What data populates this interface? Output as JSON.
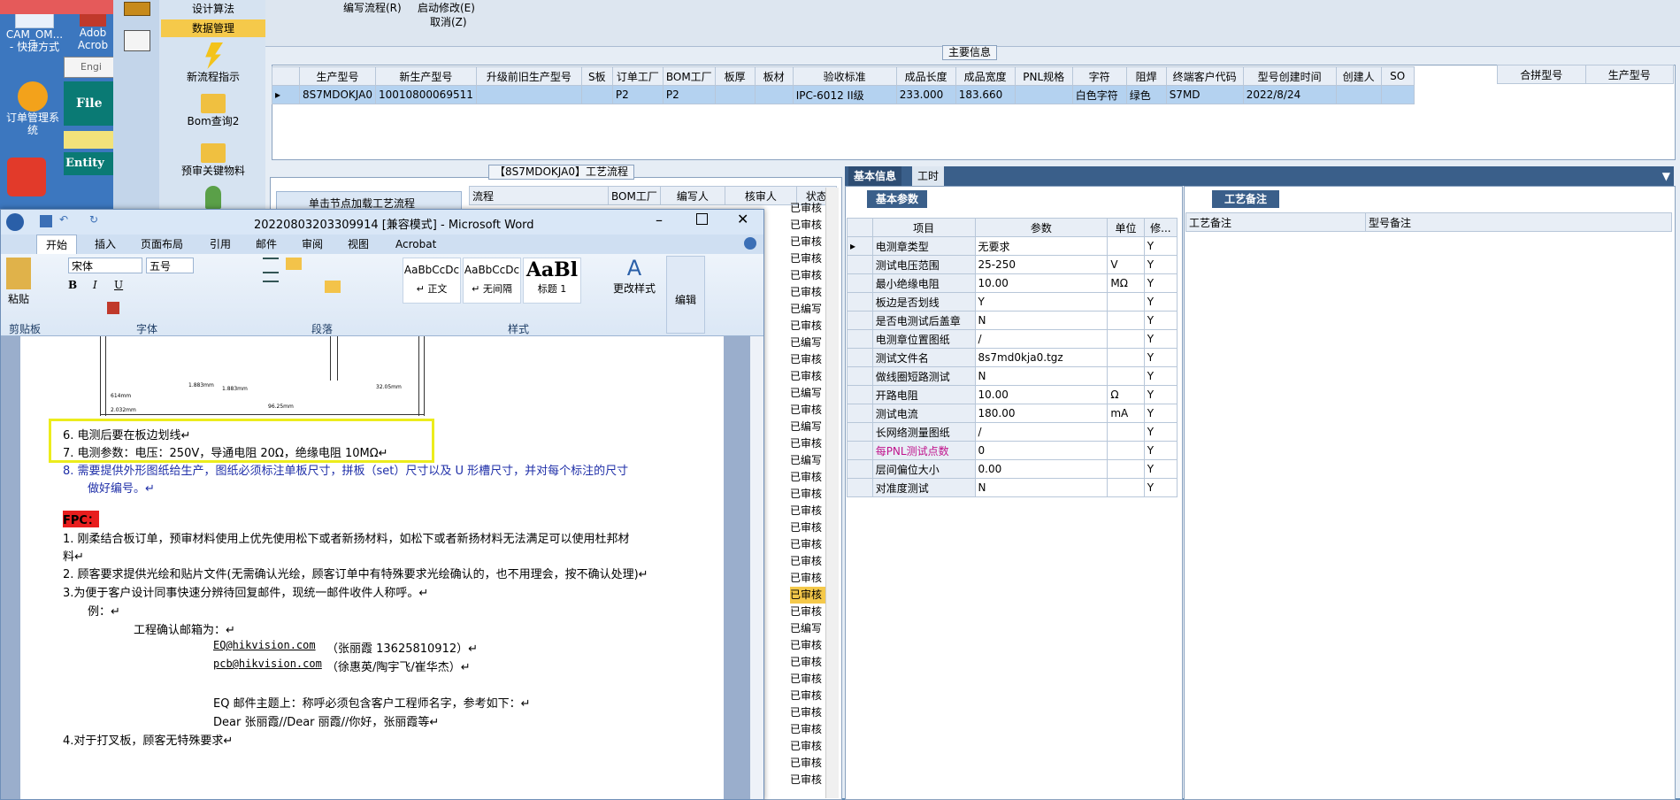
{
  "desktop": {
    "icons": [
      {
        "label": "CAM_OM...\n- 快捷方式"
      },
      {
        "label": "Adob\nAcrob"
      },
      {
        "label": "订单管理系\n统"
      }
    ],
    "engine_label": "Engi",
    "file_label": "File",
    "entity_label": "Entity"
  },
  "nav": {
    "item_algorithm": "设计算法",
    "item_data": "数据管理",
    "tool_new_flow": "新流程指示",
    "tool_bom": "Bom查询2",
    "tool_preaudit": "预审关键物料"
  },
  "menu": {
    "edit_flow": "编写流程(R)",
    "start_modify": "启动修改(E)",
    "cancel": "取消(Z)"
  },
  "main_info": {
    "title": "主要信息",
    "headers": [
      "生产型号",
      "新生产型号",
      "升级前旧生产型号",
      "S板",
      "订单工厂",
      "BOM工厂",
      "板厚",
      "板材",
      "验收标准",
      "成品长度",
      "成品宽度",
      "PNL规格",
      "字符",
      "阻焊",
      "终端客户代码",
      "型号创建时间",
      "创建人",
      "SO"
    ],
    "row": [
      "8S7MDOKJA0",
      "10010800069511",
      "",
      "",
      "P2",
      "P2",
      "",
      "",
      "IPC-6012 II级",
      "233.000",
      "183.660",
      "",
      "白色字符",
      "绿色",
      "S7MD",
      "2022/8/24",
      "",
      ""
    ],
    "side_headers": [
      "合拼型号",
      "生产型号"
    ]
  },
  "process": {
    "title": "【8S7MDOKJA0】工艺流程",
    "load_hint": "单击节点加载工艺流程",
    "headers": [
      "流程",
      "BOM工厂",
      "编写人",
      "核审人",
      "状态"
    ],
    "statuses": [
      "已审核",
      "已审核",
      "已审核",
      "已审核",
      "已审核",
      "已审核",
      "已编写",
      "已审核",
      "已编写",
      "已审核",
      "已审核",
      "已编写",
      "已审核",
      "已编写",
      "已审核",
      "已编写",
      "已审核",
      "已审核",
      "已审核",
      "已审核",
      "已审核",
      "已审核",
      "已审核",
      "已审核",
      "已审核",
      "已编写",
      "已审核",
      "已审核",
      "已审核",
      "已审核",
      "已审核",
      "已审核",
      "已审核",
      "已审核",
      "已审核"
    ]
  },
  "basic_tabs": {
    "tab_basic": "基本信息",
    "tab_time": "工时",
    "sub_tab": "基本参数",
    "notes_tab": "工艺备注"
  },
  "params": {
    "headers": [
      "项目",
      "参数",
      "单位",
      "修..."
    ],
    "rows": [
      {
        "item": "电测章类型",
        "value": "无要求",
        "unit": "",
        "flag": "Y"
      },
      {
        "item": "测试电压范围",
        "value": "25-250",
        "unit": "V",
        "flag": "Y"
      },
      {
        "item": "最小绝缘电阻",
        "value": "10.00",
        "unit": "MΩ",
        "flag": "Y"
      },
      {
        "item": "板边是否划线",
        "value": "Y",
        "unit": "",
        "flag": "Y"
      },
      {
        "item": "是否电测试后盖章",
        "value": "N",
        "unit": "",
        "flag": "Y"
      },
      {
        "item": "电测章位置图纸",
        "value": "/",
        "unit": "",
        "flag": "Y"
      },
      {
        "item": "测试文件名",
        "value": "8s7md0kja0.tgz",
        "unit": "",
        "flag": "Y"
      },
      {
        "item": "做线圈短路测试",
        "value": "N",
        "unit": "",
        "flag": "Y"
      },
      {
        "item": "开路电阻",
        "value": "10.00",
        "unit": "Ω",
        "flag": "Y"
      },
      {
        "item": "测试电流",
        "value": "180.00",
        "unit": "mA",
        "flag": "Y"
      },
      {
        "item": "长网络测量图纸",
        "value": "/",
        "unit": "",
        "flag": "Y"
      },
      {
        "item": "每PNL测试点数",
        "value": "0",
        "unit": "",
        "flag": "Y"
      },
      {
        "item": "层间偏位大小",
        "value": "0.00",
        "unit": "",
        "flag": "Y"
      },
      {
        "item": "对准度测试",
        "value": "N",
        "unit": "",
        "flag": "Y"
      }
    ]
  },
  "notes": {
    "headers": [
      "工艺备注",
      "型号备注"
    ]
  },
  "word": {
    "title": "20220803203309914 [兼容模式] - Microsoft Word",
    "tabs": [
      "开始",
      "插入",
      "页面布局",
      "引用",
      "邮件",
      "审阅",
      "视图",
      "Acrobat"
    ],
    "font_name": "宋体",
    "font_size": "五号",
    "paste": "粘贴",
    "groups": [
      "剪贴板",
      "字体",
      "段落",
      "样式"
    ],
    "styles": [
      {
        "preview": "AaBbCcDc",
        "name": "↵ 正文"
      },
      {
        "preview": "AaBbCcDc",
        "name": "↵ 无间隔"
      },
      {
        "preview": "AaBl",
        "name": "标题 1"
      }
    ],
    "change_style": "更改样式",
    "edit": "编辑",
    "drawing_labels": [
      "1.883mm",
      "1.883mm",
      "614mm",
      "2.032mm",
      "96.25mm",
      "32.05mm"
    ],
    "lines": [
      "6.   电测后要在板边划线↵",
      "7.   电测参数：电压：250V，导通电阻 20Ω，绝缘电阻 10MΩ↵",
      "8.   需要提供外形图纸给生产，图纸必须标注单板尺寸，拼板（set）尺寸以及 U 形槽尺寸，并对每个标注的尺寸",
      "做好编号。↵",
      "FPC：",
      "1.  刚柔结合板订单，预审材料使用上优先使用松下或者新扬材料，如松下或者新扬材料无法满足可以使用杜邦材",
      "料↵",
      "2. 顾客要求提供光绘和贴片文件(无需确认光绘，顾客订单中有特殊要求光绘确认的，也不用理会，按不确认处理)↵",
      "3.为便于客户设计同事快速分辨待回复邮件，现统一邮件收件人称呼。↵",
      "例：↵",
      "工程确认邮箱为：↵",
      "EQ@hikvision.com",
      "（张丽霞 13625810912）↵",
      "pcb@hikvision.com",
      "（徐惠英/陶宇飞/崔华杰）↵",
      "EQ 邮件主题上：称呼必须包含客户工程师名字，参考如下：↵",
      "Dear  张丽霞//Dear  丽霞//你好，张丽霞等↵",
      "4.对于打叉板，顾客无特殊要求↵"
    ]
  }
}
